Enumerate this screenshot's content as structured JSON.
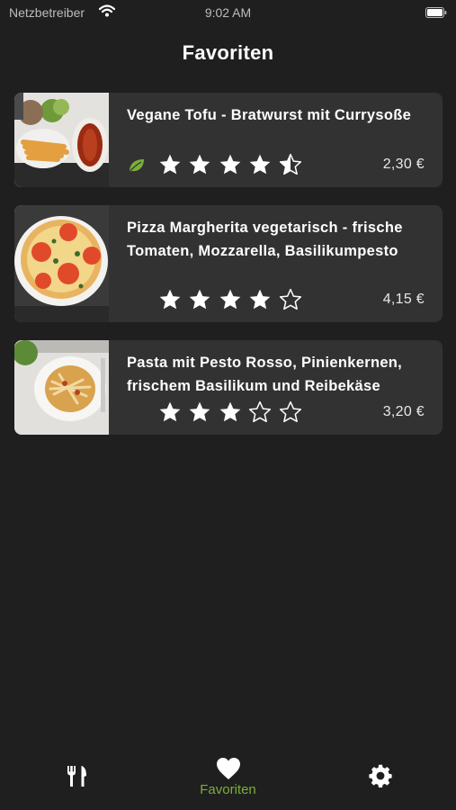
{
  "status_bar": {
    "carrier": "Netzbetreiber",
    "time": "9:02 AM"
  },
  "header": {
    "title": "Favoriten"
  },
  "favorites": [
    {
      "title": "Vegane Tofu - Bratwurst mit Currysoße",
      "rating": 4.5,
      "price": "2,30 €",
      "vegan_icon": "leaf-icon"
    },
    {
      "title": "Pizza Margherita vegetarisch - frische Tomaten, Mozzarella, Basilikumpesto",
      "rating": 4,
      "price": "4,15 €"
    },
    {
      "title": "Pasta mit Pesto Rosso, Pinienkernen, frischem Basilikum und Reibekäse",
      "rating": 3,
      "price": "3,20 €"
    }
  ],
  "tab_bar": {
    "tabs": [
      {
        "icon": "cutlery-icon",
        "label": ""
      },
      {
        "icon": "heart-icon",
        "label": "Favoriten",
        "active": true
      },
      {
        "icon": "gear-icon",
        "label": ""
      }
    ]
  },
  "colors": {
    "background": "#1f1f1f",
    "card": "#323232",
    "accent": "#7cae3a",
    "text": "#ffffff"
  }
}
